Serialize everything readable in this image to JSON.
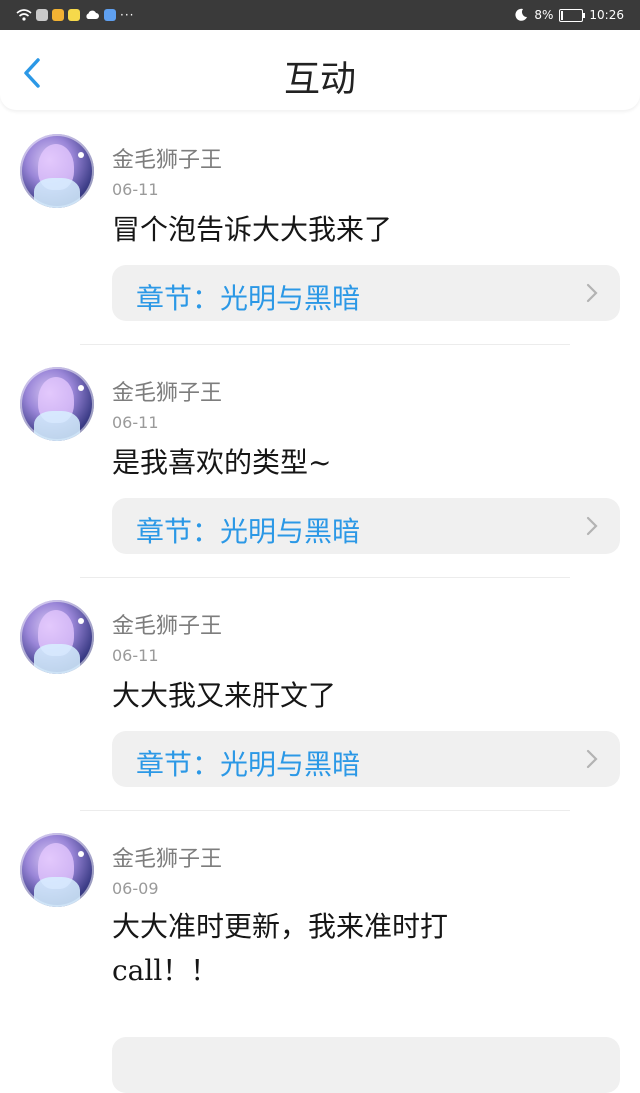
{
  "status_bar": {
    "battery": "8%",
    "time": "10:26",
    "more_indicator": "···",
    "icons": [
      "wifi-icon",
      "app-icon",
      "app-icon",
      "app-icon",
      "cloud-icon",
      "app-icon",
      "moon-icon",
      "battery-icon"
    ]
  },
  "header": {
    "title": "互动",
    "back_icon": "chevron-left-icon"
  },
  "items": [
    {
      "name": "金毛狮子王",
      "date": "06-11",
      "content": "冒个泡告诉大大我来了",
      "chapter": "章节：光明与黑暗"
    },
    {
      "name": "金毛狮子王",
      "date": "06-11",
      "content": "是我喜欢的类型~",
      "chapter": "章节：光明与黑暗"
    },
    {
      "name": "金毛狮子王",
      "date": "06-11",
      "content": "大大我又来肝文了",
      "chapter": "章节：光明与黑暗"
    },
    {
      "name": "金毛狮子王",
      "date": "06-09",
      "content": "大大准时更新，我来准时打call！！",
      "chapter": ""
    }
  ],
  "colors": {
    "accent": "#2b98e6",
    "status_bar": "#3a3a3a",
    "chapter_bg": "#f0f0f0"
  }
}
